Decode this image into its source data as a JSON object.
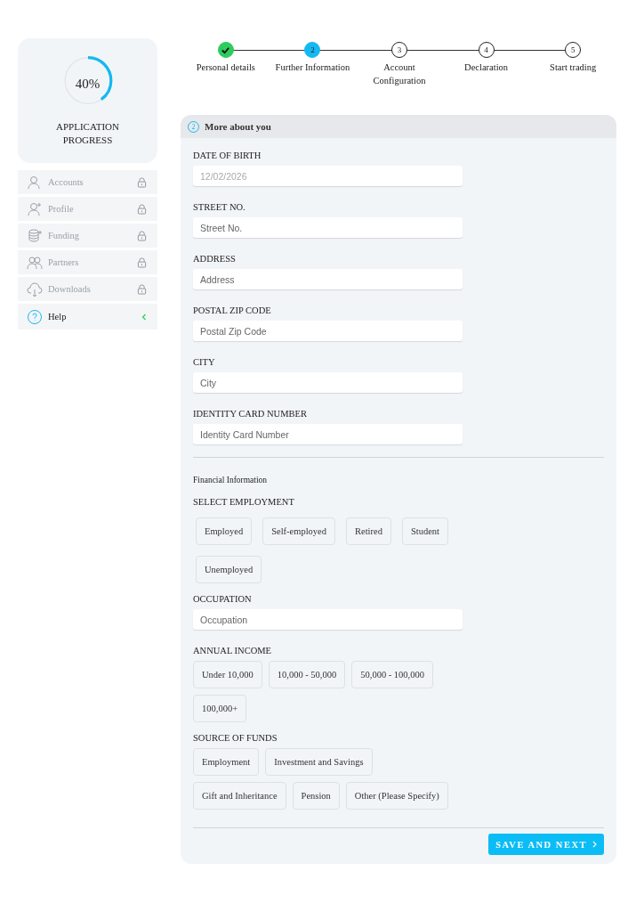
{
  "progress": {
    "percent": "40%",
    "label": "APPLICATION PROGRESS"
  },
  "sidebar": {
    "items": [
      {
        "label": "Accounts",
        "kind": "locked",
        "locked": true
      },
      {
        "label": "Profile",
        "kind": "locked",
        "locked": true
      },
      {
        "label": "Funding",
        "kind": "locked",
        "locked": true
      },
      {
        "label": "Partners",
        "kind": "locked",
        "locked": true
      },
      {
        "label": "Downloads",
        "kind": "locked",
        "locked": true
      },
      {
        "label": "Help",
        "kind": "help",
        "locked": false
      }
    ]
  },
  "steps": [
    {
      "label": "Personal details",
      "completed": true,
      "selected": false
    },
    {
      "number": "2",
      "label": "Further Information",
      "completed": false,
      "selected": true
    },
    {
      "number": "3",
      "label": "Account Configuration",
      "completed": false,
      "selected": false
    },
    {
      "number": "4",
      "label": "Declaration",
      "completed": false,
      "selected": false
    },
    {
      "number": "5",
      "label": "Start trading",
      "completed": false,
      "selected": false
    }
  ],
  "form": {
    "header": {
      "number": "2",
      "title": "More about you"
    },
    "fields": [
      {
        "label": "DATE OF BIRTH",
        "placeholder": "12/02/2026"
      },
      {
        "label": "STREET NO.",
        "placeholder": "Street No."
      },
      {
        "label": "ADDRESS",
        "placeholder": "Address"
      },
      {
        "label": "POSTAL ZIP CODE",
        "placeholder": "Postal Zip Code"
      },
      {
        "label": "CITY",
        "placeholder": "City"
      },
      {
        "label": "IDENTITY CARD NUMBER",
        "placeholder": "Identity Card Number"
      }
    ],
    "financial_title": "Financial Information",
    "employment": {
      "label": "SELECT EMPLOYMENT",
      "options": [
        {
          "label": "Employed",
          "selected": false
        },
        {
          "label": "Self-employed",
          "selected": false
        },
        {
          "label": "Retired",
          "selected": false
        },
        {
          "label": "Student",
          "selected": false
        },
        {
          "label": "Unemployed",
          "selected": false
        }
      ]
    },
    "occupation": {
      "label": "OCCUPATION",
      "placeholder": "Occupation"
    },
    "income": {
      "label": "ANNUAL INCOME",
      "options": [
        {
          "label": "Under 10,000",
          "selected": false
        },
        {
          "label": "10,000 - 50,000",
          "selected": false
        },
        {
          "label": "50,000 - 100,000",
          "selected": false
        },
        {
          "label": "100,000+",
          "selected": false
        }
      ]
    },
    "funds": {
      "label": "SOURCE OF FUNDS",
      "options": [
        {
          "label": "Employment",
          "selected": false
        },
        {
          "label": "Investment and Savings",
          "selected": false
        },
        {
          "label": "Gift and Inheritance",
          "selected": false
        },
        {
          "label": "Pension",
          "selected": false
        },
        {
          "label": "Other (Please Specify)",
          "selected": false
        }
      ]
    },
    "submit": "SAVE AND NEXT"
  }
}
